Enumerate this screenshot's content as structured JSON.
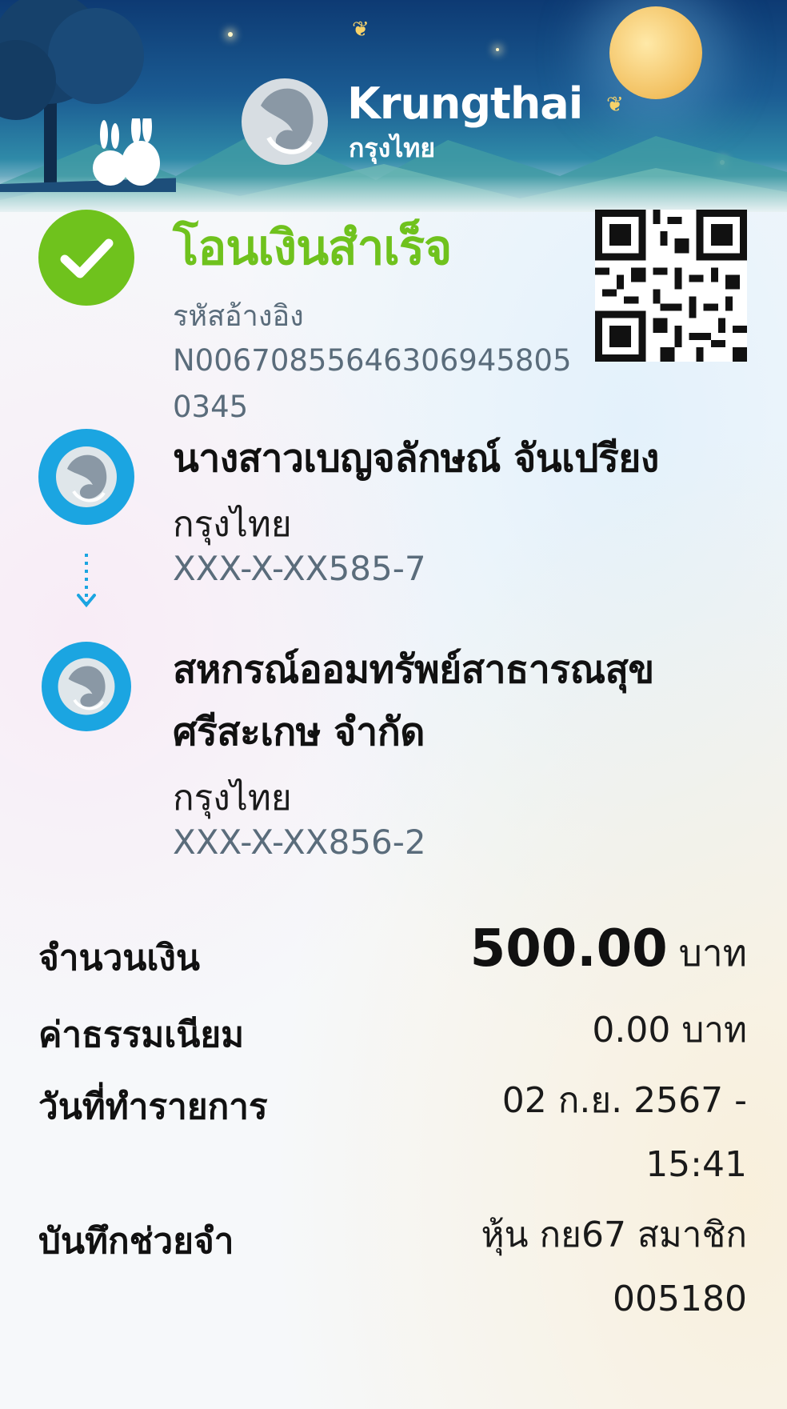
{
  "brand": {
    "name_en": "Krungthai",
    "name_th": "กรุงไทย"
  },
  "status": {
    "title": "โอนเงินสำเร็จ",
    "ref_label": "รหัสอ้างอิง",
    "ref_value": "N006708556463069458050345"
  },
  "sender": {
    "name": "นางสาวเบญจลักษณ์ จันเปรียง",
    "bank": "กรุงไทย",
    "account": "XXX-X-XX585-7"
  },
  "receiver": {
    "name_line1": "สหกรณ์ออมทรัพย์สาธารณสุข",
    "name_line2": "ศรีสะเกษ จำกัด",
    "bank": "กรุงไทย",
    "account": "XXX-X-XX856-2"
  },
  "details": {
    "amount_label": "จำนวนเงิน",
    "amount_value": "500.00",
    "amount_unit": "บาท",
    "fee_label": "ค่าธรรมเนียม",
    "fee_value": "0.00 บาท",
    "date_label": "วันที่ทำรายการ",
    "date_value_line1": "02 ก.ย. 2567 -",
    "date_value_line2": "15:41",
    "memo_label": "บันทึกช่วยจำ",
    "memo_value_line1": "หุ้น กย67 สมาชิก",
    "memo_value_line2": "005180"
  },
  "colors": {
    "success_green": "#6fc21d",
    "bank_blue": "#1ba5e1",
    "muted_text": "#5a6c7b"
  },
  "icons": [
    "checkmark-icon",
    "qr-code-icon",
    "krungthai-logo-icon",
    "arrow-down-icon"
  ]
}
